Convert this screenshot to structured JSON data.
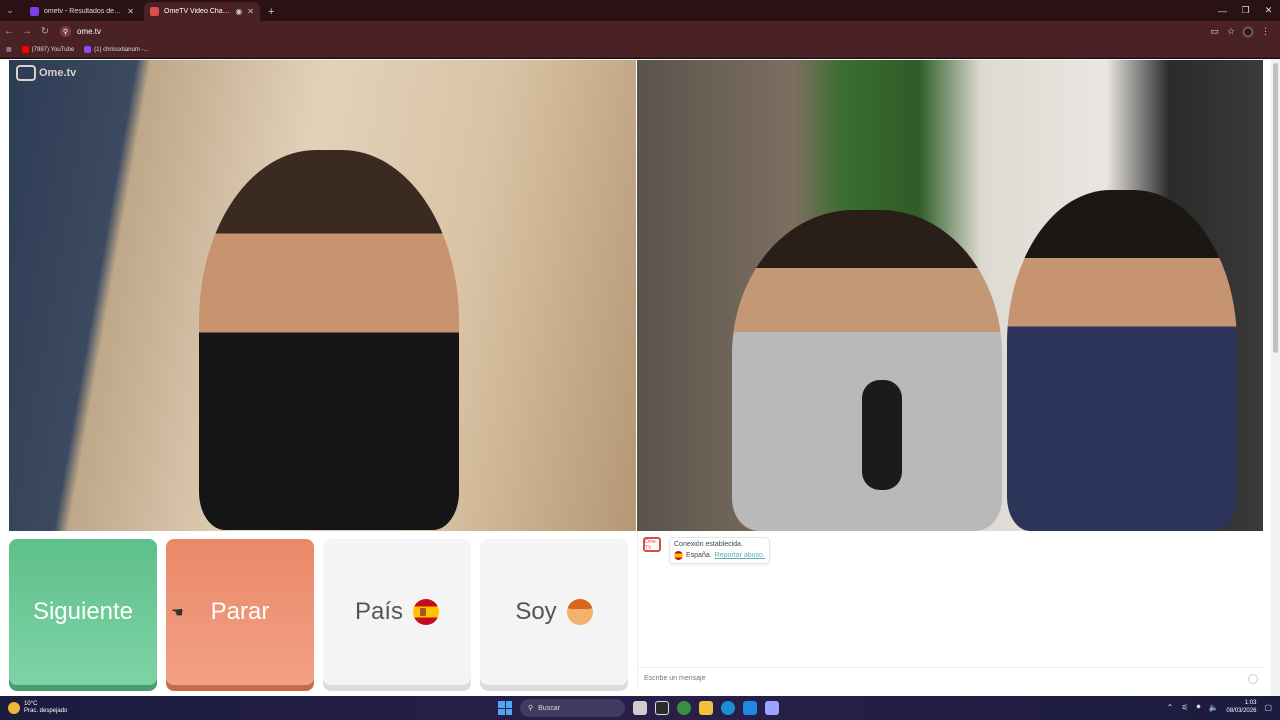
{
  "browser": {
    "tabs": [
      {
        "title": "ometv - Resultados de la búsq",
        "favicon_color": "#7b3fe4",
        "active": false
      },
      {
        "title": "OmeTV Video Chat — Ome",
        "favicon_color": "#e04b4b",
        "active": true
      }
    ],
    "new_tab_label": "+",
    "address": "ome.tv",
    "bookmarks": [
      {
        "label": "(7987) YouTube",
        "color": "#ff0000"
      },
      {
        "label": "(1) chrissxtianum -...",
        "color": "#9146ff"
      }
    ]
  },
  "ometv": {
    "logo_text": "Ome.tv",
    "buttons": {
      "next": "Siguiente",
      "stop": "Parar",
      "country": "País",
      "gender": "Soy"
    },
    "chat": {
      "logo_label": "Ome TV",
      "status": "Conexión establecida.",
      "country": "España.",
      "report": "Reportar abuso.",
      "input_placeholder": "Escribe un mensaje"
    }
  },
  "taskbar": {
    "weather_temp": "10°C",
    "weather_desc": "Prac. despejado",
    "search_label": "Buscar",
    "time": "1:03",
    "date": "08/03/2026",
    "app_colors": [
      "#cfcfcf",
      "#2b2b2b",
      "#3c8e42",
      "#4285f4",
      "#f3c23c",
      "#1a8fd6",
      "#1e88e5",
      "#9aa4ff"
    ]
  }
}
